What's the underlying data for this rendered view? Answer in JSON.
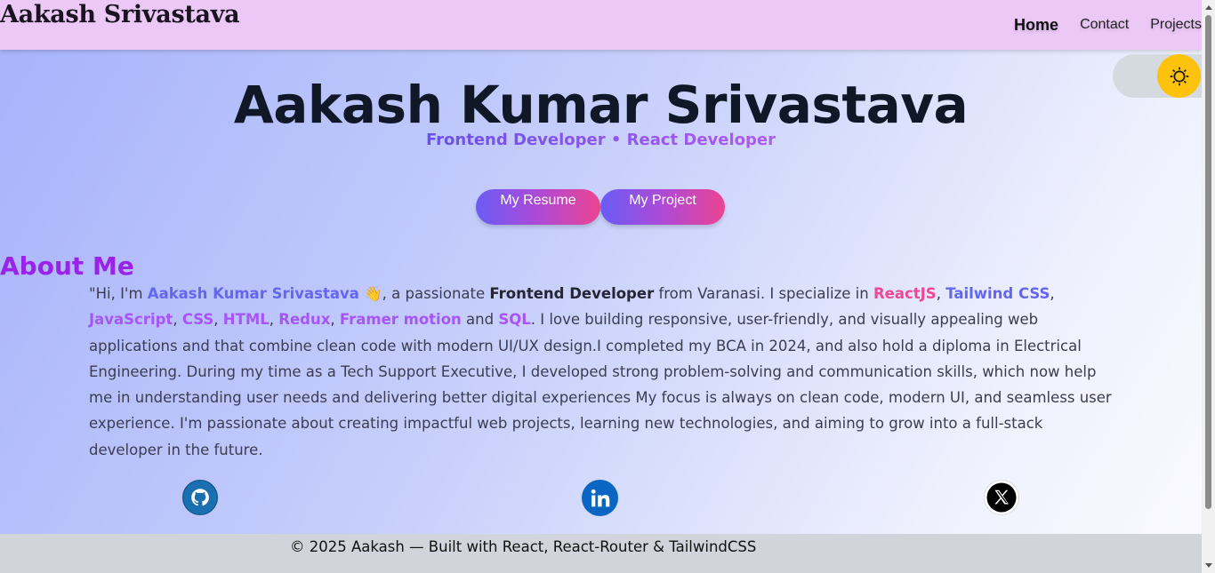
{
  "header": {
    "brand": "Aakash Srivastava",
    "nav": {
      "home": "Home",
      "contact": "Contact",
      "projects": "Projects"
    }
  },
  "theme_toggle": {
    "icon": "sun-icon",
    "knob_color": "#fcc20c"
  },
  "hero": {
    "title": "Aakash Kumar Srivastava",
    "subtitle": "Frontend Developer • React Developer",
    "buttons": {
      "resume": "My Resume",
      "project": "My Project"
    }
  },
  "about": {
    "heading": "About Me",
    "t1": "\"Hi, I'm ",
    "name": "Aakash Kumar Srivastava",
    "emoji": "👋",
    "t2": ", a passionate ",
    "role": "Frontend Developer",
    "t3": " from Varanasi. I specialize in ",
    "skill_react": "ReactJS",
    "sep1": ", ",
    "skill_tailwind": "Tailwind CSS",
    "sep2": ", ",
    "skill_js": "JavaScript",
    "sep3": ", ",
    "skill_css": "CSS",
    "sep4": ", ",
    "skill_html": "HTML",
    "sep5": ", ",
    "skill_redux": "Redux",
    "sep6": ", ",
    "skill_framer": "Framer motion",
    "t4": " and ",
    "skill_sql": "SQL",
    "t5": ". I love building responsive, user-friendly, and visually appealing web applications and that combine clean code with modern UI/UX design.I completed my BCA in 2024, and also hold a diploma in Electrical Engineering. During my time as a Tech Support Executive, I developed strong problem-solving and communication skills, which now help me in understanding user needs and delivering better digital experiences My focus is always on clean code, modern UI, and seamless user experience. I'm passionate about creating impactful web projects, learning new technologies, and aiming to grow into a full-stack developer in the future."
  },
  "social": {
    "github_icon": "github-icon",
    "linkedin_icon": "linkedin-icon",
    "x_icon": "x-icon"
  },
  "footer": {
    "text": "© 2025 Aakash — Built with React, React-Router & TailwindCSS"
  },
  "colors": {
    "header_bg": "#ecc8f7",
    "accent_purple": "#9b22e8",
    "accent_blue": "#6366f1",
    "accent_pink": "#ec4899",
    "footer_bg": "#d1d5db"
  }
}
